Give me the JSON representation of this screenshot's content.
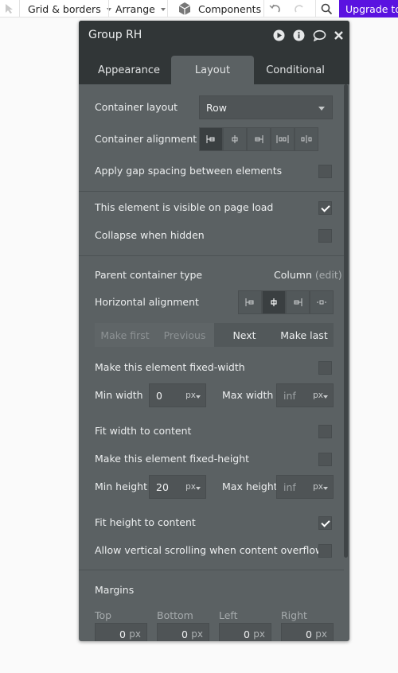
{
  "toolbar": {
    "grid_borders": "Grid & borders",
    "arrange": "Arrange",
    "components": "Components",
    "upgrade": "Upgrade to"
  },
  "panel": {
    "title": "Group RH",
    "tabs": [
      "Appearance",
      "Layout",
      "Conditional"
    ],
    "active_tab": "Layout"
  },
  "layout": {
    "container_layout_label": "Container layout",
    "container_layout_value": "Row",
    "container_alignment_label": "Container alignment",
    "gap_label": "Apply gap spacing between elements",
    "gap_checked": false,
    "visible_label": "This element is visible on page load",
    "visible_checked": true,
    "collapse_label": "Collapse when hidden",
    "collapse_checked": false,
    "parent_type_label": "Parent container type",
    "parent_type_value": "Column",
    "parent_type_edit": "(edit)",
    "halign_label": "Horizontal alignment",
    "order_buttons": [
      "Make first",
      "Previous",
      "Next",
      "Make last"
    ],
    "fixed_width_label": "Make this element fixed-width",
    "fixed_width_checked": false,
    "min_width_label": "Min width",
    "min_width_value": "0",
    "min_width_unit": "px",
    "max_width_label": "Max width",
    "max_width_placeholder": "inf",
    "max_width_unit": "px",
    "fit_width_label": "Fit width to content",
    "fit_width_checked": false,
    "fixed_height_label": "Make this element fixed-height",
    "fixed_height_checked": false,
    "min_height_label": "Min height",
    "min_height_value": "20",
    "min_height_unit": "px",
    "max_height_label": "Max height",
    "max_height_placeholder": "inf",
    "max_height_unit": "px",
    "fit_height_label": "Fit height to content",
    "fit_height_checked": true,
    "vscroll_label": "Allow vertical scrolling when content overflows",
    "vscroll_checked": false
  },
  "margins": {
    "title": "Margins",
    "fields": [
      {
        "label": "Top",
        "value": "0",
        "unit": "px"
      },
      {
        "label": "Bottom",
        "value": "0",
        "unit": "px"
      },
      {
        "label": "Left",
        "value": "0",
        "unit": "px"
      },
      {
        "label": "Right",
        "value": "0",
        "unit": "px"
      }
    ]
  },
  "colors": {
    "panel_bg": "#5b6163",
    "header_bg": "#313637",
    "upgrade_bg": "#5a12e0"
  }
}
